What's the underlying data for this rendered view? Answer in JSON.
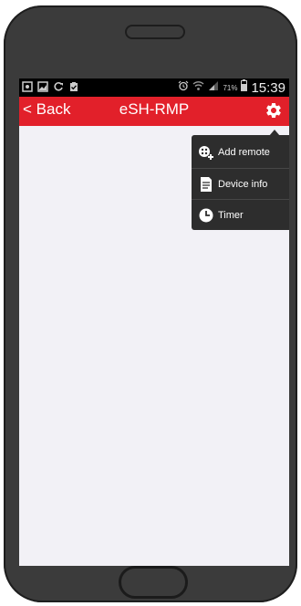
{
  "status_bar": {
    "icons_left": [
      "app-icon",
      "image-icon",
      "sync-icon",
      "clipboard-check-icon"
    ],
    "icons_right": [
      "alarm-icon",
      "wifi-icon",
      "signal-icon",
      "battery-icon"
    ],
    "battery_percent": "71%",
    "time": "15:39"
  },
  "app_bar": {
    "back_label": "< Back",
    "title": "eSH-RMP",
    "settings_icon": "gear-icon",
    "accent_color": "#e2202a"
  },
  "menu": {
    "items": [
      {
        "label": "Add remote",
        "icon": "add-remote-icon"
      },
      {
        "label": "Device info",
        "icon": "document-icon"
      },
      {
        "label": "Timer",
        "icon": "clock-icon"
      }
    ]
  }
}
